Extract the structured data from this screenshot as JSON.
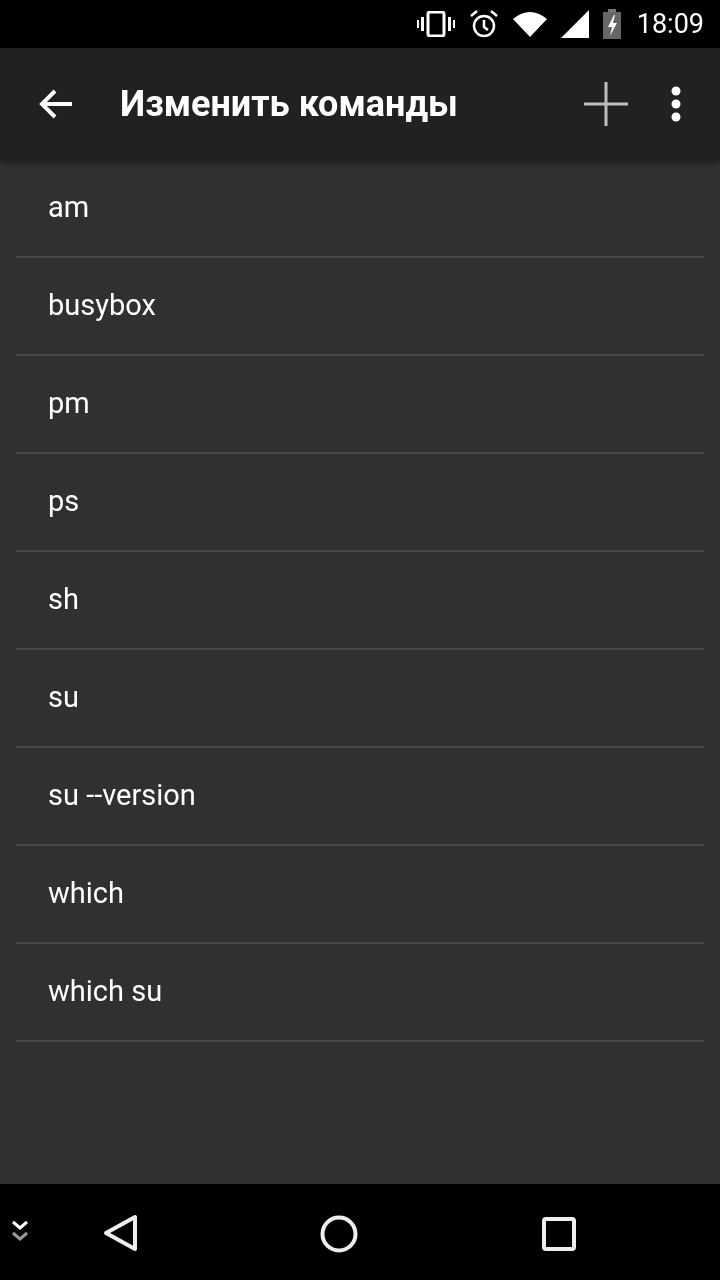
{
  "status_bar": {
    "time": "18:09"
  },
  "app_bar": {
    "title": "Изменить команды"
  },
  "commands": [
    {
      "label": "am"
    },
    {
      "label": "busybox"
    },
    {
      "label": "pm"
    },
    {
      "label": "ps"
    },
    {
      "label": "sh"
    },
    {
      "label": "su"
    },
    {
      "label": "su --version"
    },
    {
      "label": "which"
    },
    {
      "label": "which su"
    }
  ]
}
